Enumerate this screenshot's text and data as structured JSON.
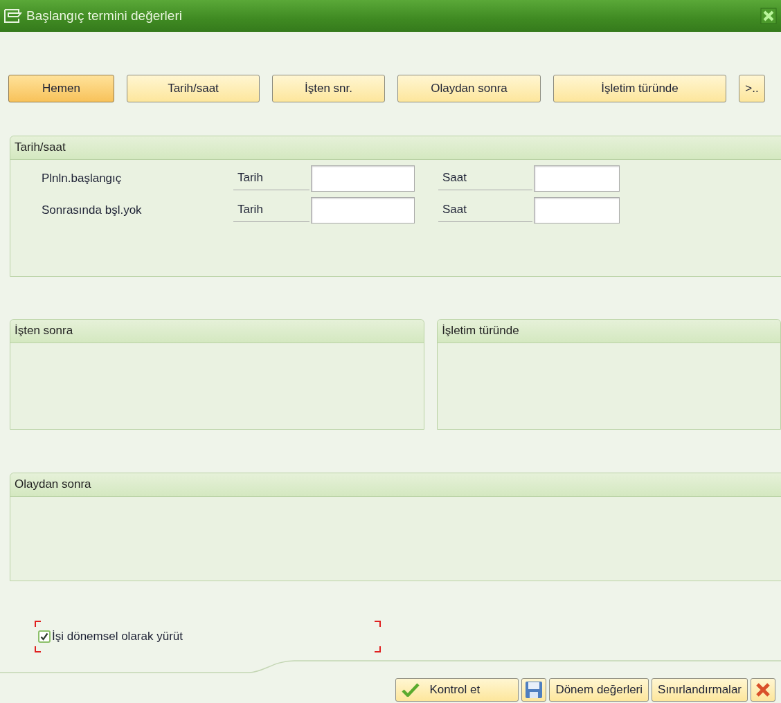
{
  "window": {
    "title": "Başlangıç termini değerleri"
  },
  "mode_buttons": [
    {
      "label": "Hemen",
      "selected": true
    },
    {
      "label": "Tarih/saat",
      "selected": false
    },
    {
      "label": "İşten snr.",
      "selected": false
    },
    {
      "label": "Olaydan sonra",
      "selected": false
    },
    {
      "label": "İşletim türünde",
      "selected": false
    },
    {
      "label": ">..",
      "selected": false
    }
  ],
  "date_time_group": {
    "title": "Tarih/saat",
    "rows": [
      {
        "label": "Plnln.başlangıç",
        "date_label": "Tarih",
        "time_label": "Saat"
      },
      {
        "label": "Sonrasında bşl.yok",
        "date_label": "Tarih",
        "time_label": "Saat"
      }
    ]
  },
  "after_job_group": {
    "title": "İşten sonra"
  },
  "operation_mode_group": {
    "title": "İşletim türünde"
  },
  "after_event_group": {
    "title": "Olaydan sonra"
  },
  "periodic_checkbox": {
    "label": "İşi dönemsel olarak yürüt",
    "checked": true
  },
  "footer_buttons": [
    {
      "kind": "check",
      "label": "Kontrol et"
    },
    {
      "kind": "save"
    },
    {
      "kind": "text",
      "label": "Dönem değerleri"
    },
    {
      "kind": "text",
      "label": "Sınırlandırmalar"
    },
    {
      "kind": "cancel"
    }
  ]
}
